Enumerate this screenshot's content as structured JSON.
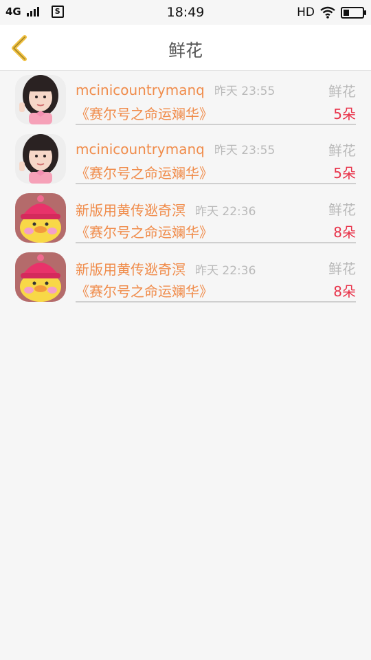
{
  "status_bar": {
    "network": "4G",
    "time": "18:49",
    "hd": "HD",
    "icons": [
      "signal-icon",
      "sim-s-icon",
      "wifi-icon",
      "battery-icon"
    ]
  },
  "header": {
    "title": "鲜花",
    "back_icon": "chevron-left-icon",
    "accent_color": "#f0c040"
  },
  "records": [
    {
      "avatar": "girl-avatar",
      "name": "mcinicountrymanq",
      "time": "昨天 23:55",
      "type": "鲜花",
      "book": "《赛尔号之命运斓华》",
      "count": "5朵"
    },
    {
      "avatar": "girl-avatar",
      "name": "mcinicountrymanq",
      "time": "昨天 23:55",
      "type": "鲜花",
      "book": "《赛尔号之命运斓华》",
      "count": "5朵"
    },
    {
      "avatar": "duck-avatar",
      "name": "新版用黄传逖奇溟",
      "time": "昨天 22:36",
      "type": "鲜花",
      "book": "《赛尔号之命运斓华》",
      "count": "8朵"
    },
    {
      "avatar": "duck-avatar",
      "name": "新版用黄传逖奇溟",
      "time": "昨天 22:36",
      "type": "鲜花",
      "book": "《赛尔号之命运斓华》",
      "count": "8朵"
    }
  ],
  "colors": {
    "name": "#f08c4b",
    "count": "#e8334a",
    "muted": "#b9b9b9",
    "background": "#f6f6f6"
  }
}
